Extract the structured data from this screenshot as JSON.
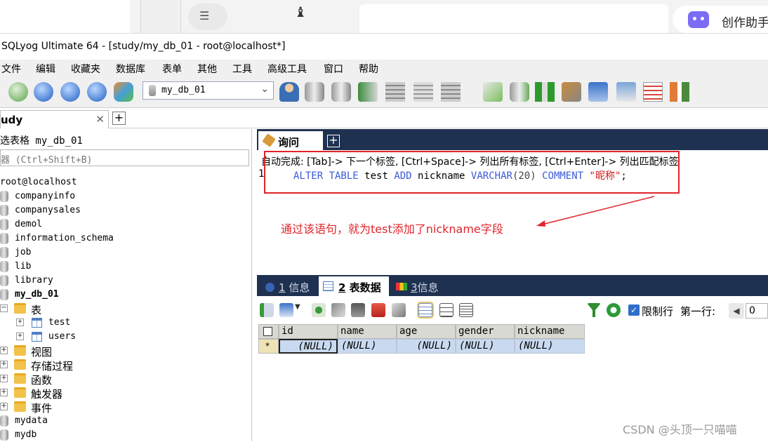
{
  "browser": {
    "assistant_label": "创作助手"
  },
  "window": {
    "title": "SQLyog Ultimate 64 - [study/my_db_01 - root@localhost*]"
  },
  "menu": [
    "文件",
    "编辑",
    "收藏夹",
    "数据库",
    "表单",
    "其他",
    "工具",
    "高级工具",
    "窗口",
    "帮助"
  ],
  "toolbar": {
    "db_selected": "my_db_01"
  },
  "connection_tab": {
    "label": "udy"
  },
  "object_browser": {
    "title": "选表格 my_db_01",
    "filter_placeholder": "器 (Ctrl+Shift+B)",
    "root": "root@localhost",
    "databases_top": [
      "companyinfo",
      "companysales",
      "demol",
      "information_schema",
      "job",
      "lib",
      "library"
    ],
    "current_db": "my_db_01",
    "tables_folder": "表",
    "tables": [
      "test",
      "users"
    ],
    "other_folders": [
      "视图",
      "存储过程",
      "函数",
      "触发器",
      "事件"
    ],
    "databases_bottom": [
      "mydata",
      "mydb"
    ]
  },
  "query_tab": {
    "label": "询问"
  },
  "editor": {
    "autocomplete_tip": "自动完成: [Tab]-> 下一个标签, [Ctrl+Space]-> 列出所有标签, [Ctrl+Enter]-> 列出匹配标签",
    "line_number": "1",
    "sql": {
      "kw1": "ALTER TABLE",
      "tbl": "test",
      "kw2": "ADD",
      "col": "nickname",
      "type": "VARCHAR",
      "len": "(20)",
      "kw3": "COMMENT",
      "comment": "\"昵称\"",
      "end": ";"
    }
  },
  "annotation": "通过该语句，就为test添加了nickname字段",
  "result_tabs": [
    {
      "num": "1",
      "label": "信息"
    },
    {
      "num": "2",
      "label": "表数据"
    },
    {
      "num": "3",
      "label": "信息"
    }
  ],
  "result_toolbar": {
    "limit_label": "限制行",
    "first_row_label": "第一行:",
    "first_row_value": "0"
  },
  "grid": {
    "columns": [
      "id",
      "name",
      "age",
      "gender",
      "nickname"
    ],
    "row_marker": "*",
    "row": [
      "(NULL)",
      "(NULL)",
      "(NULL)",
      "(NULL)",
      "(NULL)"
    ]
  },
  "watermark": "CSDN @头顶一只喵喵",
  "colors": {
    "panel_dark": "#1f3150",
    "highlight_red": "#e0242b",
    "row_blue": "#c9daf0"
  }
}
